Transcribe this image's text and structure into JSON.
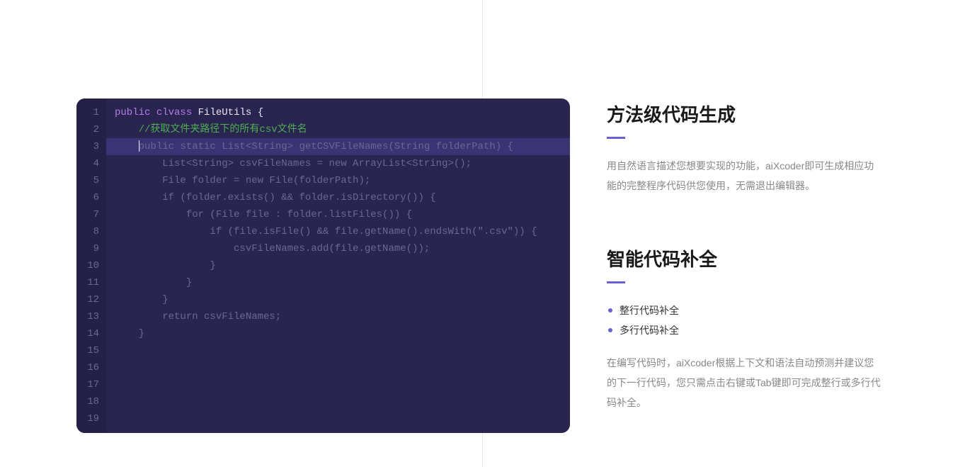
{
  "editor": {
    "lineCount": 19,
    "lines": {
      "1": {
        "tokens": [
          {
            "text": "public",
            "cls": "kw"
          },
          {
            "text": " ",
            "cls": ""
          },
          {
            "text": "clvass",
            "cls": "kw"
          },
          {
            "text": " ",
            "cls": ""
          },
          {
            "text": "FileUtils",
            "cls": "cls"
          },
          {
            "text": " ",
            "cls": ""
          },
          {
            "text": "{",
            "cls": "brace"
          }
        ]
      },
      "2": {
        "indent": "    ",
        "tokens": [
          {
            "text": "//获取文件夹路径下的所有",
            "cls": "comment"
          },
          {
            "text": "csv",
            "cls": "comment"
          },
          {
            "text": "文件名",
            "cls": "comment"
          }
        ]
      },
      "3": {
        "highlighted": true,
        "indent": "    ",
        "cursor": true,
        "text": "public static List<String> getCSVFileNames(String folderPath) {"
      },
      "4": {
        "suggestion": true,
        "text": "        List<String> csvFileNames = new ArrayList<String>();"
      },
      "5": {
        "suggestion": true,
        "text": "        File folder = new File(folderPath);"
      },
      "6": {
        "suggestion": true,
        "text": "        if (folder.exists() && folder.isDirectory()) {"
      },
      "7": {
        "suggestion": true,
        "text": "            for (File file : folder.listFiles()) {"
      },
      "8": {
        "suggestion": true,
        "text": "                if (file.isFile() && file.getName().endsWith(\".csv\")) {"
      },
      "9": {
        "suggestion": true,
        "text": "                    csvFileNames.add(file.getName());"
      },
      "10": {
        "suggestion": true,
        "text": "                }"
      },
      "11": {
        "suggestion": true,
        "text": "            }"
      },
      "12": {
        "suggestion": true,
        "text": "        }"
      },
      "13": {
        "suggestion": true,
        "text": "        return csvFileNames;"
      },
      "14": {
        "suggestion": true,
        "text": "    }"
      }
    }
  },
  "sections": {
    "method": {
      "title": "方法级代码生成",
      "desc": "用自然语言描述您想要实现的功能，aiXcoder即可生成相应功能的完整程序代码供您使用，无需退出编辑器。"
    },
    "completion": {
      "title": "智能代码补全",
      "bullets": [
        "整行代码补全",
        "多行代码补全"
      ],
      "desc": "在编写代码时，aiXcoder根据上下文和语法自动预测并建议您的下一行代码，您只需点击右键或Tab键即可完成整行或多行代码补全。"
    }
  }
}
